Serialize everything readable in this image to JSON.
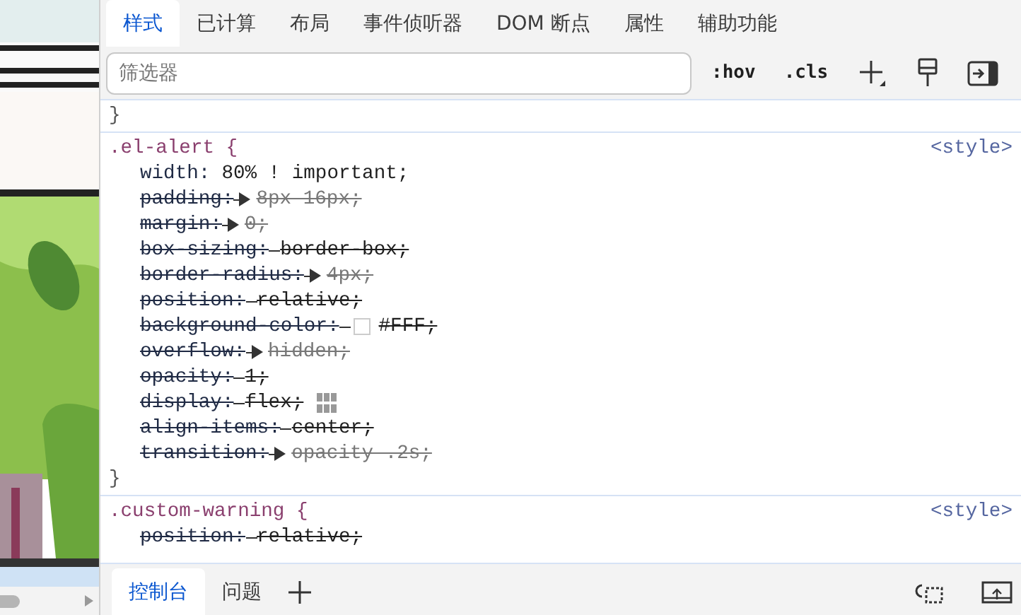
{
  "tabs": [
    {
      "label": "样式",
      "selected": true
    },
    {
      "label": "已计算",
      "selected": false
    },
    {
      "label": "布局",
      "selected": false
    },
    {
      "label": "事件侦听器",
      "selected": false
    },
    {
      "label": "DOM 断点",
      "selected": false
    },
    {
      "label": "属性",
      "selected": false
    },
    {
      "label": "辅助功能",
      "selected": false
    }
  ],
  "filter": {
    "placeholder": "筛选器"
  },
  "toolbar": [
    ":hov",
    ".cls"
  ],
  "rules": [
    {
      "close": "}"
    },
    {
      "selector": ".el-alert {",
      "origin": "<style>",
      "close": "}",
      "declarations": [
        {
          "property": "width:",
          "value": "80% ! important;",
          "overridden": false,
          "kind": "plain"
        },
        {
          "property": "padding:",
          "value": "8px 16px;",
          "overridden": true,
          "kind": "shorthand"
        },
        {
          "property": "margin:",
          "value": "0;",
          "overridden": true,
          "kind": "shorthand"
        },
        {
          "property": "box-sizing:",
          "value": "border-box;",
          "overridden": true,
          "kind": "plain"
        },
        {
          "property": "border-radius:",
          "value": "4px;",
          "overridden": true,
          "kind": "shorthand"
        },
        {
          "property": "position:",
          "value": "relative;",
          "overridden": true,
          "kind": "plain"
        },
        {
          "property": "background-color:",
          "value": "#FFF;",
          "overridden": true,
          "kind": "color",
          "color": "#ffffff"
        },
        {
          "property": "overflow:",
          "value": "hidden;",
          "overridden": true,
          "kind": "shorthand"
        },
        {
          "property": "opacity:",
          "value": "1;",
          "overridden": true,
          "kind": "plain"
        },
        {
          "property": "display:",
          "value": "flex;",
          "overridden": true,
          "kind": "flex"
        },
        {
          "property": "align-items:",
          "value": "center;",
          "overridden": true,
          "kind": "plain"
        },
        {
          "property": "transition:",
          "value": "opacity .2s;",
          "overridden": true,
          "kind": "shorthand"
        }
      ]
    },
    {
      "selector": ".custom-warning {",
      "origin": "<style>",
      "declarations": [
        {
          "property": "position:",
          "value": "relative;",
          "overridden": true,
          "kind": "plain"
        }
      ]
    }
  ],
  "drawer": {
    "tabs": [
      {
        "label": "控制台",
        "selected": true
      },
      {
        "label": "问题",
        "selected": false
      }
    ]
  }
}
